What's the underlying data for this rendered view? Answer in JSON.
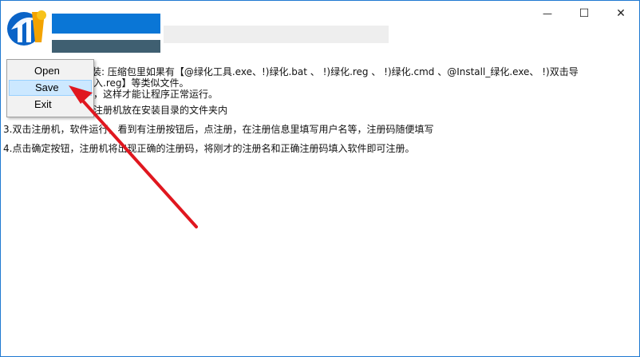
{
  "window": {
    "title_icon": "app-logo-icon",
    "controls": {
      "minimize": "—",
      "maximize": "☐",
      "close": "✕"
    }
  },
  "content_lines": [
    "要安装: 压缩包里如果有【@绿化工具.exe、!)绿化.bat 、 !)绿化.reg 、 !)绿化.cmd 、@Install_绿化.exe、 !)双击导",
    "入.reg】等类似文件。",
    "，这样才能让程序正常运行。",
    "注册机放在安装目录的文件夹内",
    "3.双击注册机，软件运行，看到有注册按钮后，点注册，在注册信息里填写用户名等，注册码随便填写",
    "4.点击确定按钮，注册机将出现正确的注册码，将刚才的注册名和正确注册码填入软件即可注册。"
  ],
  "context_menu": {
    "items": [
      {
        "label": "Open",
        "selected": false
      },
      {
        "label": "Save",
        "selected": true
      },
      {
        "label": "Exit",
        "selected": false
      }
    ]
  },
  "colors": {
    "arrow": "#e0171f",
    "accent_blue": "#0a76d6",
    "dark_bar": "#3f5f71",
    "selection": "#cce8ff"
  }
}
